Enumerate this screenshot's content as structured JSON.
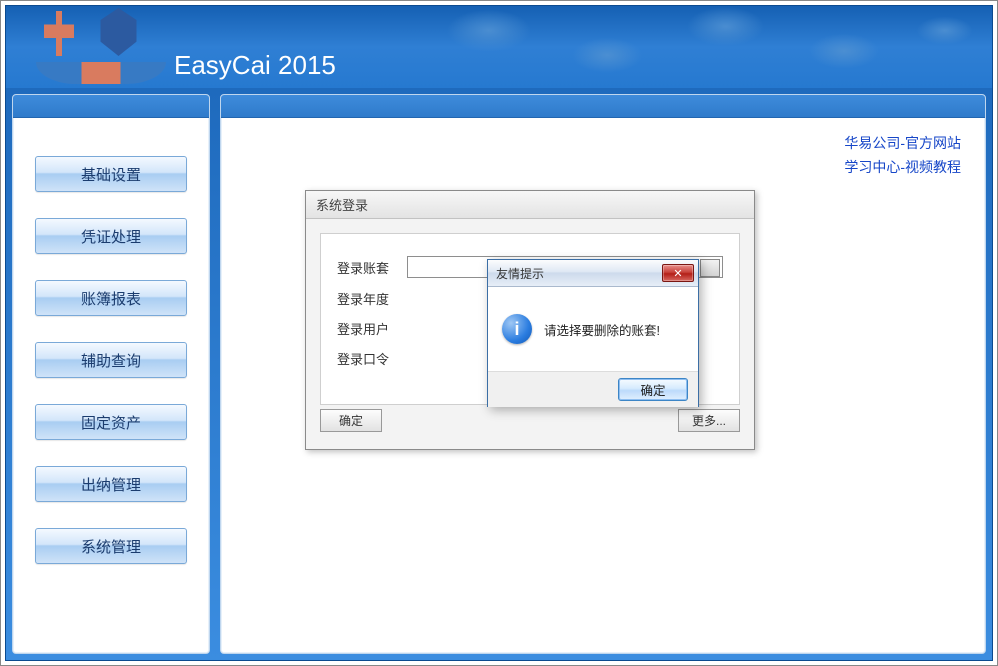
{
  "app": {
    "title": "EasyCai 2015"
  },
  "sidebar": {
    "items": [
      {
        "label": "基础设置"
      },
      {
        "label": "凭证处理"
      },
      {
        "label": "账簿报表"
      },
      {
        "label": "辅助查询"
      },
      {
        "label": "固定资产"
      },
      {
        "label": "出纳管理"
      },
      {
        "label": "系统管理"
      }
    ]
  },
  "links": {
    "official": "华易公司-官方网站",
    "tutorial": "学习中心-视频教程"
  },
  "login": {
    "title": "系统登录",
    "fields": {
      "account": "登录账套",
      "year": "登录年度",
      "user": "登录用户",
      "password": "登录口令"
    },
    "buttons": {
      "ok": "确定",
      "more": "更多..."
    }
  },
  "message": {
    "title": "友情提示",
    "text": "请选择要删除的账套!",
    "ok": "确定",
    "icon_char": "i"
  }
}
